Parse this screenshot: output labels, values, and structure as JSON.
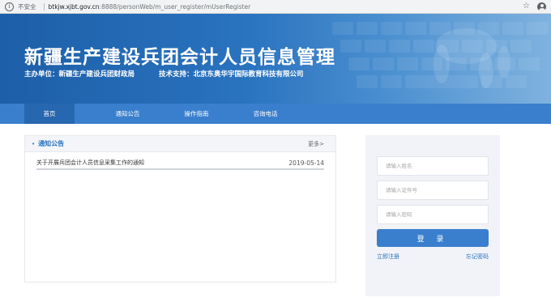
{
  "browser": {
    "security_label": "不安全",
    "url_host": "btkjw.xjbt.gov.cn",
    "url_path": ":8888/personWeb/m_user_register/mUserRegister"
  },
  "header": {
    "title": "新疆生产建设兵团会计人员信息管理",
    "host_unit": "主办单位：新疆生产建设兵团财政局",
    "tech_support": "技术支持：北京东奥华宇国际教育科技有限公司"
  },
  "nav": {
    "items": [
      {
        "label": "首页",
        "active": true
      },
      {
        "label": "通知公告"
      },
      {
        "label": "操作指南"
      },
      {
        "label": "咨询电话"
      }
    ]
  },
  "notices": {
    "title": "通知公告",
    "more": "更多>",
    "items": [
      {
        "text": "关于开展兵团会计人员信息采集工作的通知",
        "date": "2019-05-14"
      }
    ]
  },
  "login": {
    "name_placeholder": "请输入姓名",
    "id_placeholder": "请输入证件号",
    "password_placeholder": "请输入密码",
    "submit": "登 录",
    "register": "立即注册",
    "forgot": "忘记密码"
  },
  "colors": {
    "brand_blue": "#2a73bf",
    "nav_blue": "#3a7fcd",
    "nav_active": "#2767b0"
  },
  "icons": {
    "info": "info-circle-icon",
    "bookmark": "star-icon",
    "account": "account-icon"
  }
}
